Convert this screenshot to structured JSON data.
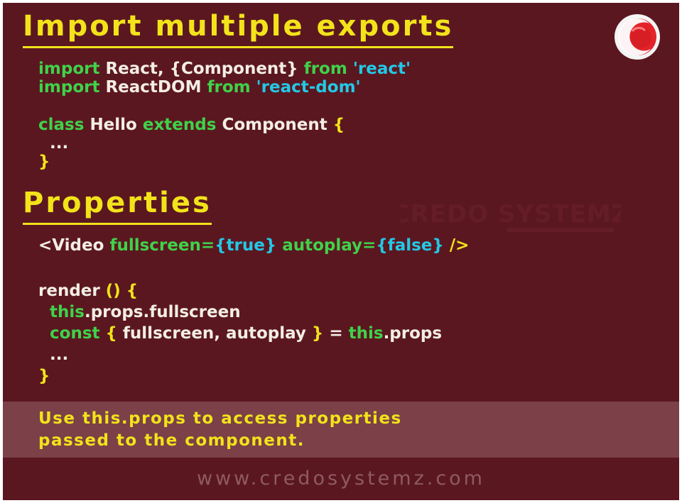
{
  "headings": {
    "import": "Import multiple exports",
    "properties": "Properties"
  },
  "import_code": {
    "line1": {
      "kw1": "import",
      "name": "React, {Component}",
      "kw2": "from",
      "str": "'react'"
    },
    "line2": {
      "kw1": "import",
      "name": "ReactDOM",
      "kw2": "from",
      "str": "'react-dom'"
    },
    "line3": {
      "kw1": "class",
      "name": "Hello",
      "kw2": "extends",
      "parent": "Component",
      "brace": "{"
    },
    "line4": {
      "ellipsis": "..."
    },
    "line5": {
      "brace": "}"
    }
  },
  "props_code": {
    "jsx": {
      "open": "<Video",
      "attr1": "fullscreen",
      "eq1": "=",
      "val1": "{true}",
      "attr2": "autoplay",
      "eq2": "=",
      "val2": "{false}",
      "close": "/>"
    },
    "render": {
      "name": "render",
      "parens": "()",
      "brace": "{"
    },
    "line_props": {
      "kw": "this",
      "rest": ".props.fullscreen"
    },
    "line_const": {
      "kw": "const",
      "open": "{",
      "vars": "fullscreen, autoplay",
      "close": "}",
      "eq": "=",
      "kw2": "this",
      "rest": ".props"
    },
    "ellipsis": "...",
    "end_brace": "}"
  },
  "note": "Use this.props to access properties passed to the component.",
  "footer": "www.credosystemz.com",
  "colors": {
    "background": "#5b1720",
    "heading": "#f2e31a",
    "keyword": "#3fd24a",
    "string": "#22c9e6",
    "text": "#f3eee4",
    "note_band": "#7b4048"
  },
  "icons": {
    "logo": "credo-logo-icon",
    "watermark": "credo-systemz-watermark"
  }
}
